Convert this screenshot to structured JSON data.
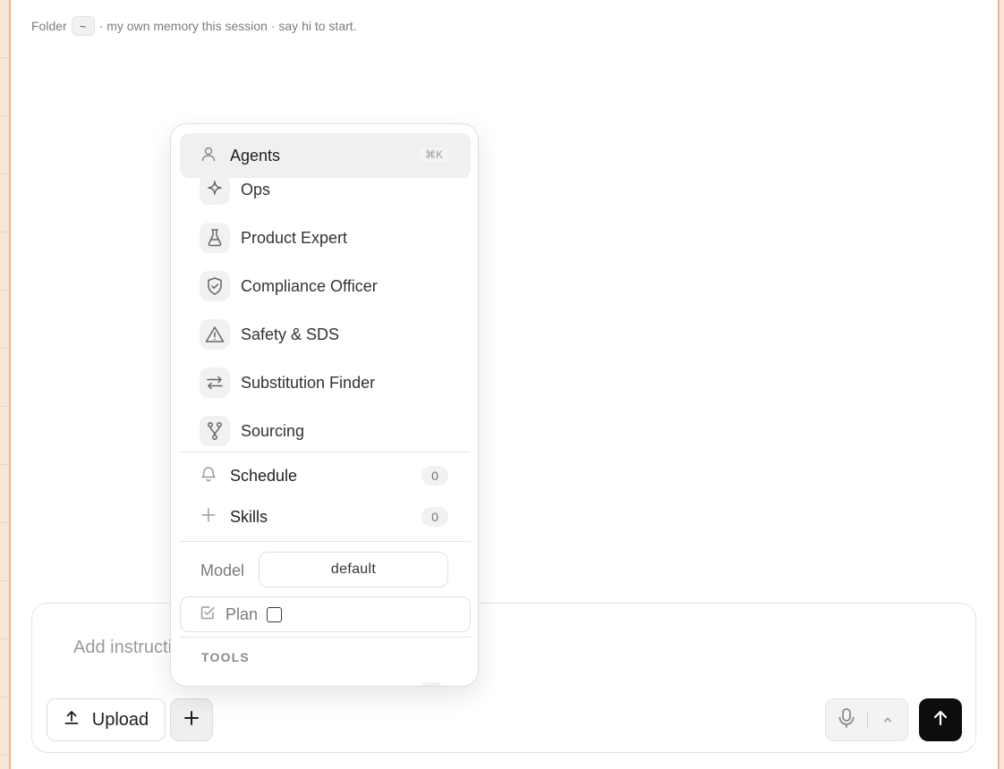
{
  "header": {
    "folder_label": "Folder",
    "folder_value": "~",
    "rest": "· my own memory this session · say hi to start."
  },
  "menu": {
    "agents": {
      "label": "Agents",
      "shortcut": "⌘K",
      "icon": "user-icon"
    },
    "agent_items": [
      {
        "label": "Ops",
        "icon": "sparkle-icon"
      },
      {
        "label": "Product Expert",
        "icon": "flask-icon"
      },
      {
        "label": "Compliance Officer",
        "icon": "shield-check-icon"
      },
      {
        "label": "Safety & SDS",
        "icon": "warning-triangle-icon"
      },
      {
        "label": "Substitution Finder",
        "icon": "swap-arrows-icon"
      },
      {
        "label": "Sourcing",
        "icon": "branch-icon"
      }
    ],
    "schedule": {
      "label": "Schedule",
      "count": "0",
      "icon": "bell-icon"
    },
    "skills": {
      "label": "Skills",
      "count": "0",
      "icon": "plus-icon"
    },
    "model": {
      "label": "Model",
      "value": "default"
    },
    "plan": {
      "label": "Plan",
      "checked": false,
      "icon": "checkbox-icon"
    },
    "tools_header": "TOOLS"
  },
  "composer": {
    "placeholder": "Add instructions...",
    "upload_label": "Upload"
  },
  "colors": {
    "frame_border": "#eab58f",
    "send_button": "#0d0d0d",
    "background": "#f6e7da"
  }
}
